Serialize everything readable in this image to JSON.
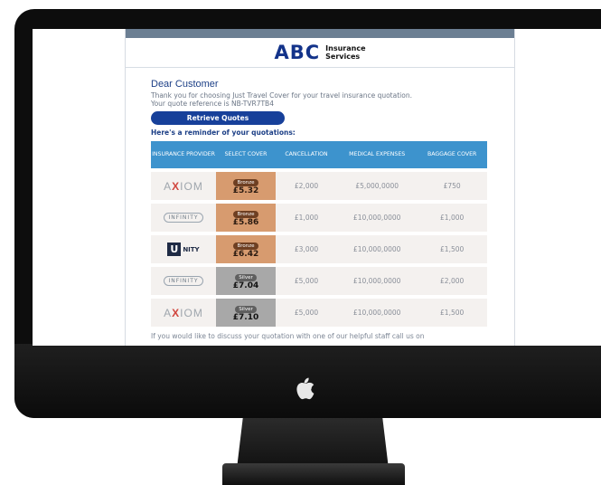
{
  "brand": {
    "name": "ABC",
    "sub1": "Insurance",
    "sub2": "Services"
  },
  "greeting": "Dear Customer",
  "intro_line1": "Thank you for choosing Just Travel Cover for your travel insurance quotation.",
  "intro_line2": "Your quote reference is NB-TVR7TB4",
  "retrieve_label": "Retrieve Quotes",
  "reminder": "Here's a reminder of your quotations:",
  "table": {
    "headers": [
      "INSURANCE PROVIDER",
      "SELECT COVER",
      "CANCELLATION",
      "MEDICAL EXPENSES",
      "BAGGAGE COVER"
    ],
    "rows": [
      {
        "provider": "AXIOM",
        "tier": "Bronze",
        "price": "£5.32",
        "cancellation": "£2,000",
        "medical": "£5,000,0000",
        "baggage": "£750"
      },
      {
        "provider": "INFINITY",
        "tier": "Bronze",
        "price": "£5.86",
        "cancellation": "£1,000",
        "medical": "£10,000,0000",
        "baggage": "£1,000"
      },
      {
        "provider": "UNITY",
        "tier": "Bronze",
        "price": "£6.42",
        "cancellation": "£3,000",
        "medical": "£10,000,0000",
        "baggage": "£1,500"
      },
      {
        "provider": "INFINITY",
        "tier": "Silver",
        "price": "£7.04",
        "cancellation": "£5,000",
        "medical": "£10,000,0000",
        "baggage": "£2,000"
      },
      {
        "provider": "AXIOM",
        "tier": "Silver",
        "price": "£7.10",
        "cancellation": "£5,000",
        "medical": "£10,000,0000",
        "baggage": "£1,500"
      }
    ]
  },
  "footer_text": "If you would like to discuss your quotation with one of our helpful staff call us on"
}
